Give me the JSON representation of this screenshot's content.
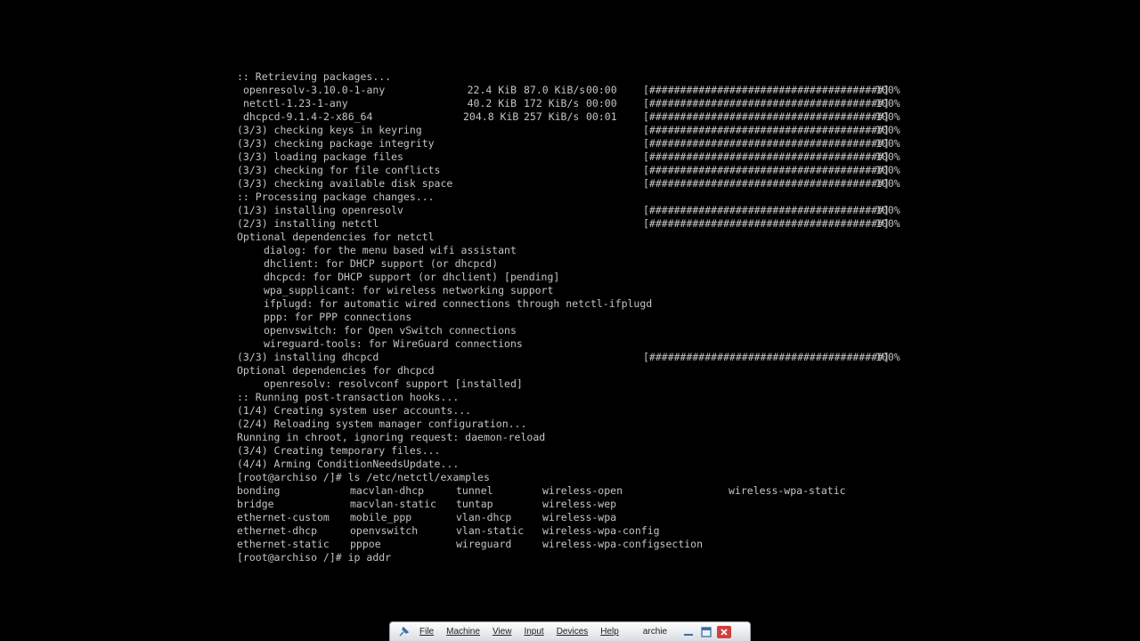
{
  "console": {
    "header1": ":: Retrieving packages...",
    "downloads": [
      {
        "name": "openresolv-3.10.0-1-any",
        "size": "22.4 KiB",
        "rate": "87.0 KiB/s",
        "time": "00:00",
        "bar": "[######################################]",
        "pct": "100%"
      },
      {
        "name": "netctl-1.23-1-any",
        "size": "40.2 KiB",
        "rate": "172 KiB/s",
        "time": "00:00",
        "bar": "[######################################]",
        "pct": "100%"
      },
      {
        "name": "dhcpcd-9.1.4-2-x86_64",
        "size": "204.8 KiB",
        "rate": "257 KiB/s",
        "time": "00:01",
        "bar": "[######################################]",
        "pct": "100%"
      }
    ],
    "checks": [
      {
        "text": "(3/3) checking keys in keyring",
        "bar": "[######################################]",
        "pct": "100%"
      },
      {
        "text": "(3/3) checking package integrity",
        "bar": "[######################################]",
        "pct": "100%"
      },
      {
        "text": "(3/3) loading package files",
        "bar": "[######################################]",
        "pct": "100%"
      },
      {
        "text": "(3/3) checking for file conflicts",
        "bar": "[######################################]",
        "pct": "100%"
      },
      {
        "text": "(3/3) checking available disk space",
        "bar": "[######################################]",
        "pct": "100%"
      }
    ],
    "header2": ":: Processing package changes...",
    "install1": {
      "text": "(1/3) installing openresolv",
      "bar": "[######################################]",
      "pct": "100%"
    },
    "install2": {
      "text": "(2/3) installing netctl",
      "bar": "[######################################]",
      "pct": "100%"
    },
    "optdeps_netctl_header": "Optional dependencies for netctl",
    "optdeps_netctl": [
      "dialog: for the menu based wifi assistant",
      "dhclient: for DHCP support (or dhcpcd)",
      "dhcpcd: for DHCP support (or dhclient) [pending]",
      "wpa_supplicant: for wireless networking support",
      "ifplugd: for automatic wired connections through netctl-ifplugd",
      "ppp: for PPP connections",
      "openvswitch: for Open vSwitch connections",
      "wireguard-tools: for WireGuard connections"
    ],
    "install3": {
      "text": "(3/3) installing dhcpcd",
      "bar": "[######################################]",
      "pct": "100%"
    },
    "optdeps_dhcpcd_header": "Optional dependencies for dhcpcd",
    "optdeps_dhcpcd": [
      "openresolv: resolvconf support [installed]"
    ],
    "header3": ":: Running post-transaction hooks...",
    "hooks": [
      "(1/4) Creating system user accounts...",
      "(2/4) Reloading system manager configuration...",
      "Running in chroot, ignoring request: daemon-reload",
      "(3/4) Creating temporary files...",
      "(4/4) Arming ConditionNeedsUpdate..."
    ],
    "prompt1": "[root@archiso /]# ls /etc/netctl/examples",
    "ls_rows": [
      [
        "bonding",
        "macvlan-dhcp",
        "tunnel",
        "wireless-open",
        "wireless-wpa-static"
      ],
      [
        "bridge",
        "macvlan-static",
        "tuntap",
        "wireless-wep",
        ""
      ],
      [
        "ethernet-custom",
        "mobile_ppp",
        "vlan-dhcp",
        "wireless-wpa",
        ""
      ],
      [
        "ethernet-dhcp",
        "openvswitch",
        "vlan-static",
        "wireless-wpa-config",
        ""
      ],
      [
        "ethernet-static",
        "pppoe",
        "wireguard",
        "wireless-wpa-configsection",
        ""
      ]
    ],
    "prompt2": "[root@archiso /]# ip addr"
  },
  "toolbar": {
    "pin_icon": "pin-icon",
    "menus": [
      "File",
      "Machine",
      "View",
      "Input",
      "Devices",
      "Help"
    ],
    "vm_title": "archie",
    "minimize_icon": "minimize-icon",
    "exit_fullscreen_icon": "restore-icon",
    "close_icon": "close-icon"
  },
  "colors": {
    "background": "#000000",
    "console_text": "#c4c4c4",
    "close_red": "#d04040"
  }
}
